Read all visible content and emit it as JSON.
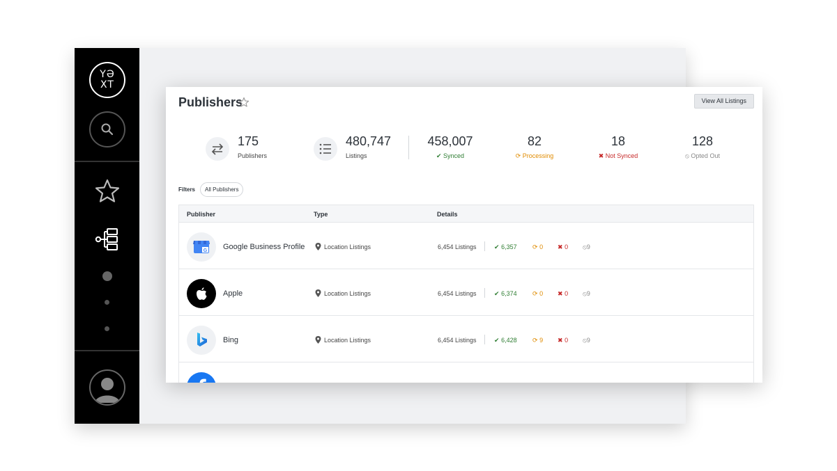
{
  "sidebar": {
    "logo_text": "Y E X T"
  },
  "page": {
    "title": "Publishers",
    "view_all_label": "View All Listings"
  },
  "stats": {
    "publishers": {
      "value": "175",
      "label": "Publishers"
    },
    "listings": {
      "value": "480,747",
      "label": "Listings"
    },
    "synced": {
      "value": "458,007",
      "label": "Synced"
    },
    "processing": {
      "value": "82",
      "label": "Processing"
    },
    "not_synced": {
      "value": "18",
      "label": "Not Synced"
    },
    "opted_out": {
      "value": "128",
      "label": "Opted Out"
    }
  },
  "filters": {
    "label": "Filters",
    "chip": "All Publishers"
  },
  "table": {
    "headers": {
      "publisher": "Publisher",
      "type": "Type",
      "details": "Details"
    },
    "rows": [
      {
        "name": "Google Business Profile",
        "type": "Location Listings",
        "listings": "6,454 Listings",
        "synced": "6,357",
        "processing": "0",
        "not_synced": "0",
        "opted_out": "9"
      },
      {
        "name": "Apple",
        "type": "Location Listings",
        "listings": "6,454 Listings",
        "synced": "6,374",
        "processing": "0",
        "not_synced": "0",
        "opted_out": "9"
      },
      {
        "name": "Bing",
        "type": "Location Listings",
        "listings": "6,454 Listings",
        "synced": "6,428",
        "processing": "9",
        "not_synced": "0",
        "opted_out": "9"
      }
    ]
  },
  "colors": {
    "synced": "#2e7d32",
    "processing": "#e08b00",
    "not_synced": "#c62828",
    "opted_out": "#888888",
    "sidebar_bg": "#000000"
  }
}
